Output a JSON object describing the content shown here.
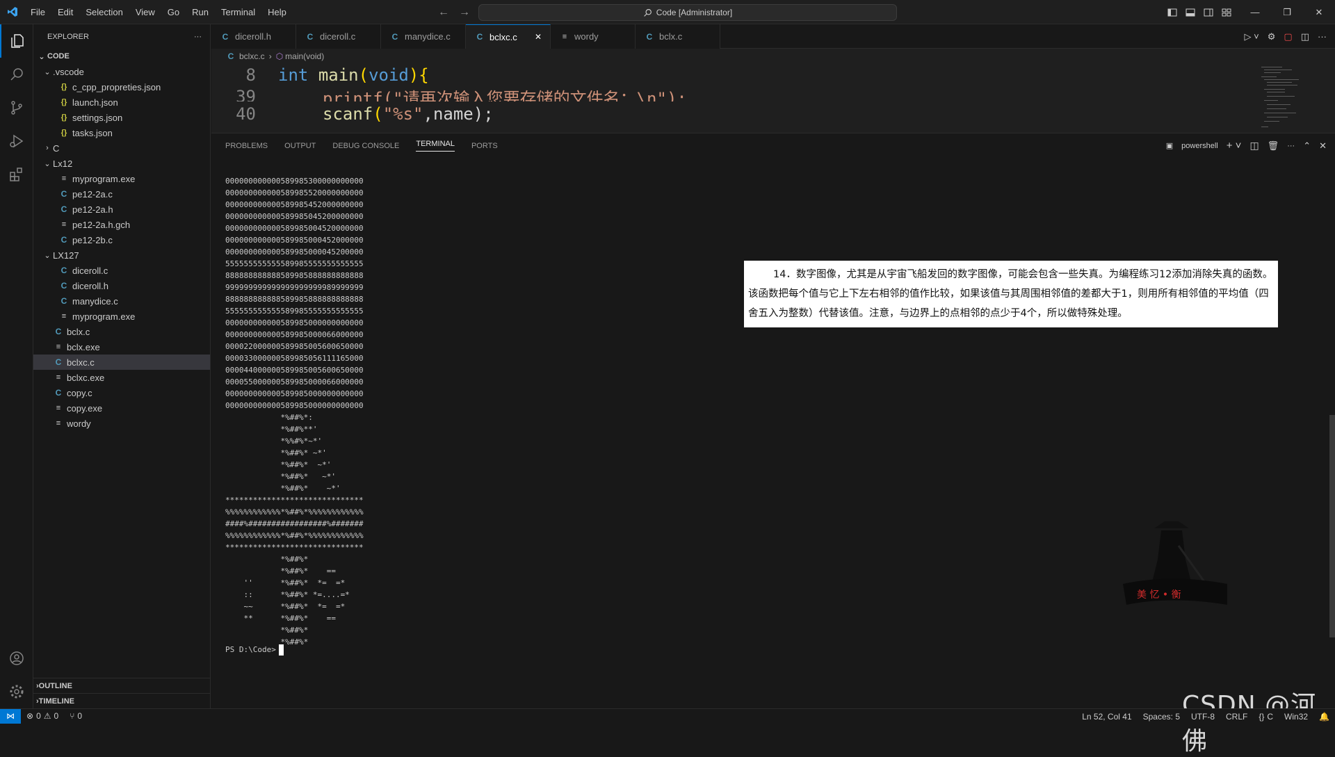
{
  "titlebar": {
    "menu": [
      "File",
      "Edit",
      "Selection",
      "View",
      "Go",
      "Run",
      "Terminal",
      "Help"
    ],
    "command_center": "Code [Administrator]"
  },
  "explorer": {
    "title": "EXPLORER",
    "root": "CODE",
    "tree": [
      {
        "label": ".vscode",
        "type": "folder",
        "depth": 1,
        "open": true
      },
      {
        "label": "c_cpp_propreties.json",
        "type": "json",
        "depth": 2
      },
      {
        "label": "launch.json",
        "type": "json",
        "depth": 2
      },
      {
        "label": "settings.json",
        "type": "json",
        "depth": 2
      },
      {
        "label": "tasks.json",
        "type": "json",
        "depth": 2
      },
      {
        "label": "C",
        "type": "folder",
        "depth": 1,
        "open": false
      },
      {
        "label": "Lx12",
        "type": "folder",
        "depth": 1,
        "open": true
      },
      {
        "label": "myprogram.exe",
        "type": "file",
        "depth": 2
      },
      {
        "label": "pe12-2a.c",
        "type": "c",
        "depth": 2
      },
      {
        "label": "pe12-2a.h",
        "type": "c",
        "depth": 2
      },
      {
        "label": "pe12-2a.h.gch",
        "type": "file",
        "depth": 2
      },
      {
        "label": "pe12-2b.c",
        "type": "c",
        "depth": 2
      },
      {
        "label": "LX127",
        "type": "folder",
        "depth": 1,
        "open": true
      },
      {
        "label": "diceroll.c",
        "type": "c",
        "depth": 2
      },
      {
        "label": "diceroll.h",
        "type": "c",
        "depth": 2
      },
      {
        "label": "manydice.c",
        "type": "c",
        "depth": 2
      },
      {
        "label": "myprogram.exe",
        "type": "file",
        "depth": 2
      },
      {
        "label": "bclx.c",
        "type": "c",
        "depth": 1
      },
      {
        "label": "bclx.exe",
        "type": "file",
        "depth": 1
      },
      {
        "label": "bclxc.c",
        "type": "c",
        "depth": 1,
        "selected": true
      },
      {
        "label": "bclxc.exe",
        "type": "file",
        "depth": 1
      },
      {
        "label": "copy.c",
        "type": "c",
        "depth": 1
      },
      {
        "label": "copy.exe",
        "type": "file",
        "depth": 1
      },
      {
        "label": "wordy",
        "type": "file",
        "depth": 1
      }
    ],
    "outline": "OUTLINE",
    "timeline": "TIMELINE"
  },
  "tabs": [
    {
      "label": "diceroll.h",
      "icon": "C",
      "active": false
    },
    {
      "label": "diceroll.c",
      "icon": "C",
      "active": false
    },
    {
      "label": "manydice.c",
      "icon": "C",
      "active": false
    },
    {
      "label": "bclxc.c",
      "icon": "C",
      "active": true
    },
    {
      "label": "wordy",
      "icon": "≡",
      "active": false
    },
    {
      "label": "bclx.c",
      "icon": "C",
      "active": false
    }
  ],
  "breadcrumb": {
    "file": "bclxc.c",
    "symbol": "main(void)"
  },
  "code": {
    "sticky_line_no": "8",
    "sticky": {
      "kw": "int",
      "fn": "main",
      "open": "(",
      "param": "void",
      "close": "){"
    },
    "partial_line_no": "39",
    "partial_text": "printf(\"请再次输入您要存储的文件名：\\n\");",
    "line40_no": "40",
    "line40": {
      "fn": "scanf",
      "open": "(",
      "str": "\"%s\"",
      "rest": ",name);"
    }
  },
  "panel": {
    "tabs": [
      "PROBLEMS",
      "OUTPUT",
      "DEBUG CONSOLE",
      "TERMINAL",
      "PORTS"
    ],
    "active_tab": "TERMINAL",
    "shell": "powershell"
  },
  "terminal": {
    "lines": [
      "000000000000589985300000000000",
      "000000000000589985520000000000",
      "000000000000589985452000000000",
      "000000000000589985045200000000",
      "000000000000589985004520000000",
      "000000000000589985000452000000",
      "000000000000589985000045200000",
      "555555555555589985555555555555",
      "888888888888589985888888888888",
      "999999999999999999999989999999",
      "888888888888589985888888888888",
      "555555555555589985555555555555",
      "000000000000589985000000000000",
      "000000000000589985000066000000",
      "000022000000589985005600650000",
      "000033000000589985056111165000",
      "000044000000589985005600650000",
      "000055000000589985000066000000",
      "000000000000589985000000000000",
      "000000000000589985000000000000",
      "            *%##%*:",
      "            *%##%**'",
      "            *%%#%*~*'",
      "            *%##%* ~*'",
      "            *%##%*  ~*'",
      "            *%##%*   ~*'",
      "            *%##%*    ~*'",
      "******************************",
      "%%%%%%%%%%%%*%##%*%%%%%%%%%%%%",
      "####%#################%#######",
      "%%%%%%%%%%%%*%##%*%%%%%%%%%%%%",
      "******************************",
      "            *%##%*",
      "            *%##%*    ==",
      "    ''      *%##%*  *=  =*",
      "    ::      *%##%* *=....=*",
      "    ~~      *%##%*  *=  =*",
      "    **      *%##%*    ==",
      "            *%##%*",
      "            *%##%*"
    ],
    "prompt": "PS D:\\Code>"
  },
  "exercise": {
    "text": "14．数字图像，尤其是从宇宙飞船发回的数字图像，可能会包含一些失真。为编程练习12添加消除失真的函数。该函数把每个值与它上下左右相邻的值作比较，如果该值与其周围相邻值的差都大于1，则用所有相邻值的平均值（四舍五入为整数）代替该值。注意，与边界上的点相邻的点少于4个，所以做特殊处理。"
  },
  "watermark": {
    "seal_text": "美 忆 • 衡",
    "csdn": "CSDN @河佛"
  },
  "status": {
    "errors": "0",
    "warnings": "0",
    "ports": "0",
    "position": "Ln 52, Col 41",
    "spaces": "Spaces: 5",
    "encoding": "UTF-8",
    "eol": "CRLF",
    "language": "C",
    "platform": "Win32"
  },
  "colors": {
    "accent": "#0078d4",
    "c_icon": "#519aba",
    "json_icon": "#cbcb41"
  }
}
